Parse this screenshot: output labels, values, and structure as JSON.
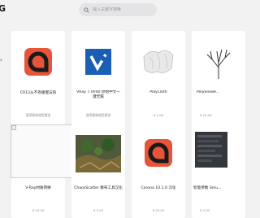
{
  "header": {
    "logo_letter": "G",
    "search_placeholder": "输入关键字搜索"
  },
  "sidebar": {
    "arrow": "›"
  },
  "products": [
    {
      "title": "CR12从不卷缓慢渲染",
      "sub": "暂停更新使用更流",
      "icon": "red-logo-icon"
    },
    {
      "title": "VRay 7.0000 原始中文一键无痕",
      "sub": "暂停更新使用更流",
      "icon": "vray-logo-icon"
    },
    {
      "title": "PolyCloth",
      "sub": "¥ 1.00",
      "icon": "cloth-thumbnail"
    },
    {
      "title": "PolySnowF...",
      "sub": "¥ 10.00",
      "icon": "tree-thumbnail"
    },
    {
      "title": "V-Ray材质转换",
      "sub": "¥ 10.00",
      "icon": "broken-image-icon"
    },
    {
      "title": "ChaosScatter 散布工具汉化",
      "sub": "¥ 2.00",
      "icon": "scatter-thumbnail"
    },
    {
      "title": "Corona 10.1.0 汉化",
      "sub": "¥ 20.00",
      "icon": "corona-logo-icon"
    },
    {
      "title": "智能参数 Smu...",
      "sub": "¥ 2.00",
      "icon": "params-thumbnail"
    }
  ]
}
